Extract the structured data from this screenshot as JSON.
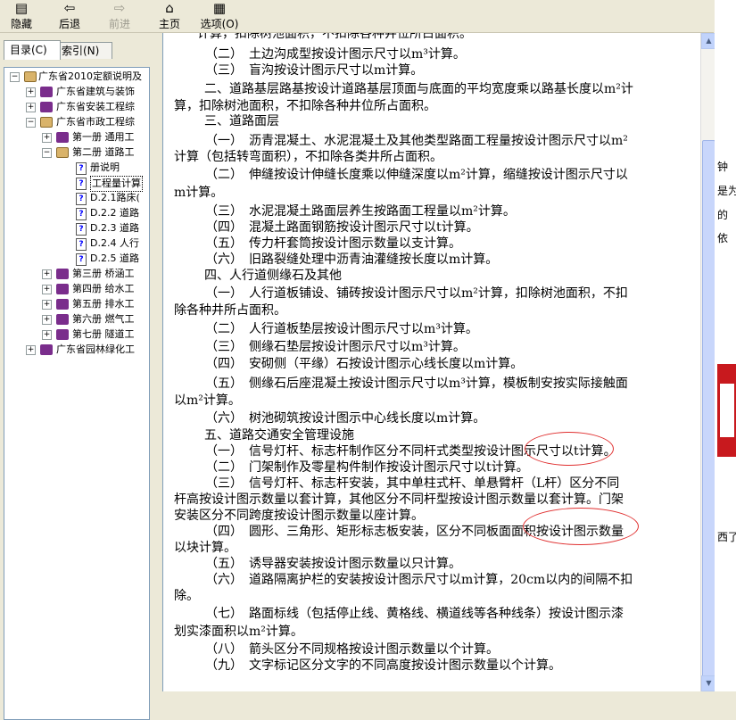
{
  "toolbar": {
    "hide": "隐藏",
    "back": "后退",
    "forward": "前进",
    "home": "主页",
    "options": "选项(O)"
  },
  "tabs": {
    "contents": "目录(C)",
    "index": "索引(N)"
  },
  "tree": [
    {
      "label": "广东省2010定额说明及"
    },
    {
      "label": "广东省建筑与装饰"
    },
    {
      "label": "广东省安装工程综"
    },
    {
      "label": "广东省市政工程综"
    },
    {
      "label": "第一册 通用工"
    },
    {
      "label": "第二册 道路工"
    },
    {
      "label": "册说明"
    },
    {
      "label": "工程量计算"
    },
    {
      "label": "D.2.1路床("
    },
    {
      "label": "D.2.2 道路"
    },
    {
      "label": "D.2.3 道路"
    },
    {
      "label": "D.2.4 人行"
    },
    {
      "label": "D.2.5 道路"
    },
    {
      "label": "第三册 桥涵工"
    },
    {
      "label": "第四册 给水工"
    },
    {
      "label": "第五册 排水工"
    },
    {
      "label": "第六册 燃气工"
    },
    {
      "label": "第七册 隧道工"
    },
    {
      "label": "广东省园林绿化工"
    }
  ],
  "content_lines": [
    "计算，扣除树池面积，不扣除各种井位所占面积。",
    "（二）　土边沟成型按设计图示尺寸以m³计算。",
    "（三）　盲沟按设计图示尺寸以m计算。",
    "二、道路基层路基按设计道路基层顶面与底面的平均宽度乘以路基长度以m²计",
    "算，扣除树池面积，不扣除各种井位所占面积。",
    "三、道路面层",
    "（一）　沥青混凝土、水泥混凝土及其他类型路面工程量按设计图示尺寸以m²",
    "计算（包括转弯面积），不扣除各类井所占面积。",
    "（二）　伸缝按设计伸缝长度乘以伸缝深度以m²计算，缩缝按设计图示尺寸以",
    "m计算。",
    "（三）　水泥混凝土路面层养生按路面工程量以m²计算。",
    "（四）　混凝土路面钢筋按设计图示尺寸以t计算。",
    "（五）　传力杆套筒按设计图示数量以支计算。",
    "（六）　旧路裂缝处理中沥青油灌缝按长度以m计算。",
    "四、人行道侧缘石及其他",
    "（一）　人行道板铺设、铺砖按设计图示尺寸以m²计算，扣除树池面积，不扣",
    "除各种井所占面积。",
    "（二）　人行道板垫层按设计图示尺寸以m³计算。",
    "（三）　侧缘石垫层按设计图示尺寸以m³计算。",
    "（四）　安砌侧（平缘）石按设计图示心线长度以m计算。",
    "（五）　侧缘石后座混凝土按设计图示尺寸以m³计算，模板制安按实际接触面",
    "以m²计算。",
    "（六）　树池砌筑按设计图示中心线长度以m计算。",
    "五、道路交通安全管理设施",
    "（一）　信号灯杆、标志杆制作区分不同杆式类型按设计图示尺寸以t计算。",
    "（二）　门架制作及零星构件制作按设计图示尺寸以t计算。",
    "（三）　信号灯杆、标志杆安装，其中单柱式杆、单悬臂杆（L杆）区分不同",
    "杆高按设计图示数量以套计算，其他区分不同杆型按设计图示数量以套计算。门架",
    "安装区分不同跨度按设计图示数量以座计算。",
    "（四）　圆形、三角形、矩形标志板安装，区分不同板面面积按设计图示数量",
    "以块计算。",
    "（五）　诱导器安装按设计图示数量以只计算。",
    "（六）　道路隔离护栏的安装按设计图示尺寸以m计算，20cm以内的间隔不扣",
    "除。",
    "（七）　路面标线（包括停止线、黄格线、横道线等各种线条）按设计图示漆",
    "划实漆面积以m²计算。",
    "（八）　箭头区分不同规格按设计图示数量以个计算。",
    "（九）　文字标记区分文字的不同高度按设计图示数量以个计算。"
  ],
  "right_strip": {
    "t1": "钟",
    "t2": "是为",
    "t3": "的",
    "t4": "依",
    "t5": "西了"
  },
  "colors": {
    "annotation": "#e03030",
    "chrome": "#ece9d8",
    "book": "#7a2d8c"
  }
}
